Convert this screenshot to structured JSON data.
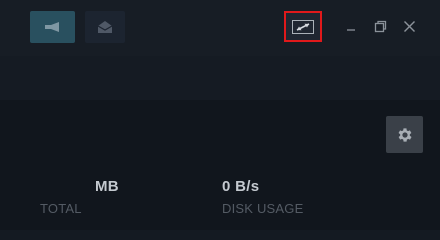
{
  "toolbar": {
    "announcement_icon": "megaphone-icon",
    "mail_icon": "envelope-icon",
    "big_picture_icon": "expand-arrows-icon",
    "highlight_color": "#e0191b"
  },
  "window_controls": {
    "minimize_icon": "minimize-icon",
    "restore_icon": "restore-icon",
    "close_icon": "close-icon"
  },
  "downloads": {
    "settings_icon": "gear-icon",
    "total_value": "MB",
    "total_label": "TOTAL",
    "disk_value": "0 B/s",
    "disk_label": "DISK USAGE"
  }
}
